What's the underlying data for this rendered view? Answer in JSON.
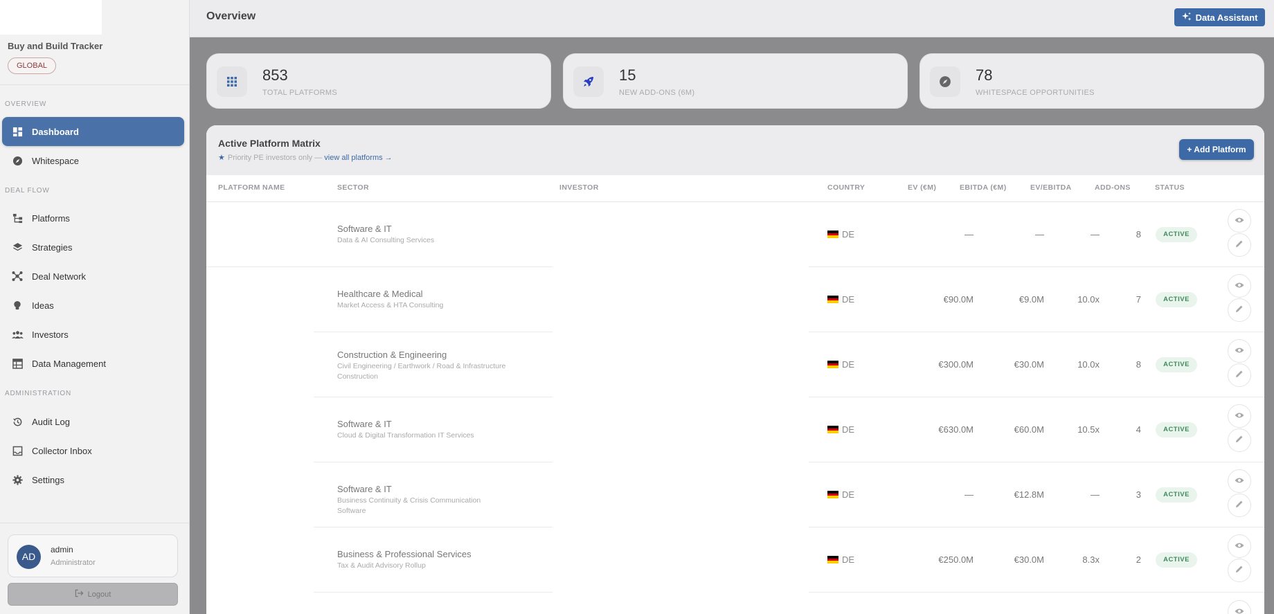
{
  "sidebar": {
    "app_title": "Buy and Build Tracker",
    "badge": "GLOBAL",
    "sections": {
      "overview": "OVERVIEW",
      "deal_flow": "DEAL FLOW",
      "administration": "ADMINISTRATION"
    },
    "items": [
      {
        "label": "Dashboard",
        "icon": "dashboard-icon"
      },
      {
        "label": "Whitespace",
        "icon": "compass-icon"
      },
      {
        "label": "Platforms",
        "icon": "hierarchy-icon"
      },
      {
        "label": "Strategies",
        "icon": "layers-icon"
      },
      {
        "label": "Deal Network",
        "icon": "network-icon"
      },
      {
        "label": "Ideas",
        "icon": "lightbulb-icon"
      },
      {
        "label": "Investors",
        "icon": "group-icon"
      },
      {
        "label": "Data Management",
        "icon": "table-icon"
      },
      {
        "label": "Audit Log",
        "icon": "history-icon"
      },
      {
        "label": "Collector Inbox",
        "icon": "inbox-icon"
      },
      {
        "label": "Settings",
        "icon": "gear-icon"
      }
    ],
    "user": {
      "initials": "AD",
      "name": "admin",
      "role": "Administrator"
    },
    "logout_label": "Logout"
  },
  "header": {
    "title": "Overview",
    "assistant_label": "Data Assistant"
  },
  "stats": [
    {
      "value": "853",
      "label": "TOTAL PLATFORMS",
      "icon": "grid-icon"
    },
    {
      "value": "15",
      "label": "NEW ADD-ONS (6M)",
      "icon": "rocket-icon"
    },
    {
      "value": "78",
      "label": "WHITESPACE OPPORTUNITIES",
      "icon": "compass-icon"
    }
  ],
  "matrix": {
    "title": "Active Platform Matrix",
    "subtitle": "Priority PE investors only —",
    "link": "view all platforms →",
    "add_label": "+ Add Platform",
    "columns": {
      "name": "PLATFORM NAME",
      "sector": "SECTOR",
      "investor": "INVESTOR",
      "country": "COUNTRY",
      "ev": "EV (€M)",
      "ebitda": "EBITDA (€M)",
      "multiple": "EV/EBITDA",
      "addons": "ADD-ONS",
      "status": "STATUS"
    },
    "rows": [
      {
        "sector": "Software & IT",
        "subsector": "Data & AI Consulting Services",
        "country": "DE",
        "ev": "—",
        "ebitda": "—",
        "multiple": "—",
        "addons": "8",
        "status": "ACTIVE"
      },
      {
        "sector": "Healthcare & Medical",
        "subsector": "Market Access & HTA Consulting",
        "country": "DE",
        "ev": "€90.0M",
        "ebitda": "€9.0M",
        "multiple": "10.0x",
        "addons": "7",
        "status": "ACTIVE"
      },
      {
        "sector": "Construction & Engineering",
        "subsector": "Civil Engineering / Earthwork / Road & Infrastructure Construction",
        "country": "DE",
        "ev": "€300.0M",
        "ebitda": "€30.0M",
        "multiple": "10.0x",
        "addons": "8",
        "status": "ACTIVE"
      },
      {
        "sector": "Software & IT",
        "subsector": "Cloud & Digital Transformation IT Services",
        "country": "DE",
        "ev": "€630.0M",
        "ebitda": "€60.0M",
        "multiple": "10.5x",
        "addons": "4",
        "status": "ACTIVE"
      },
      {
        "sector": "Software & IT",
        "subsector": "Business Continuity & Crisis Communication Software",
        "country": "DE",
        "ev": "—",
        "ebitda": "€12.8M",
        "multiple": "—",
        "addons": "3",
        "status": "ACTIVE"
      },
      {
        "sector": "Business & Professional Services",
        "subsector": "Tax & Audit Advisory Rollup",
        "country": "DE",
        "ev": "€250.0M",
        "ebitda": "€30.0M",
        "multiple": "8.3x",
        "addons": "2",
        "status": "ACTIVE"
      }
    ]
  },
  "colors": {
    "accent": "#3d6aa6",
    "active_nav": "#4a72a8",
    "status_bg": "#e8f4ec",
    "status_text": "#3f8a5a"
  }
}
